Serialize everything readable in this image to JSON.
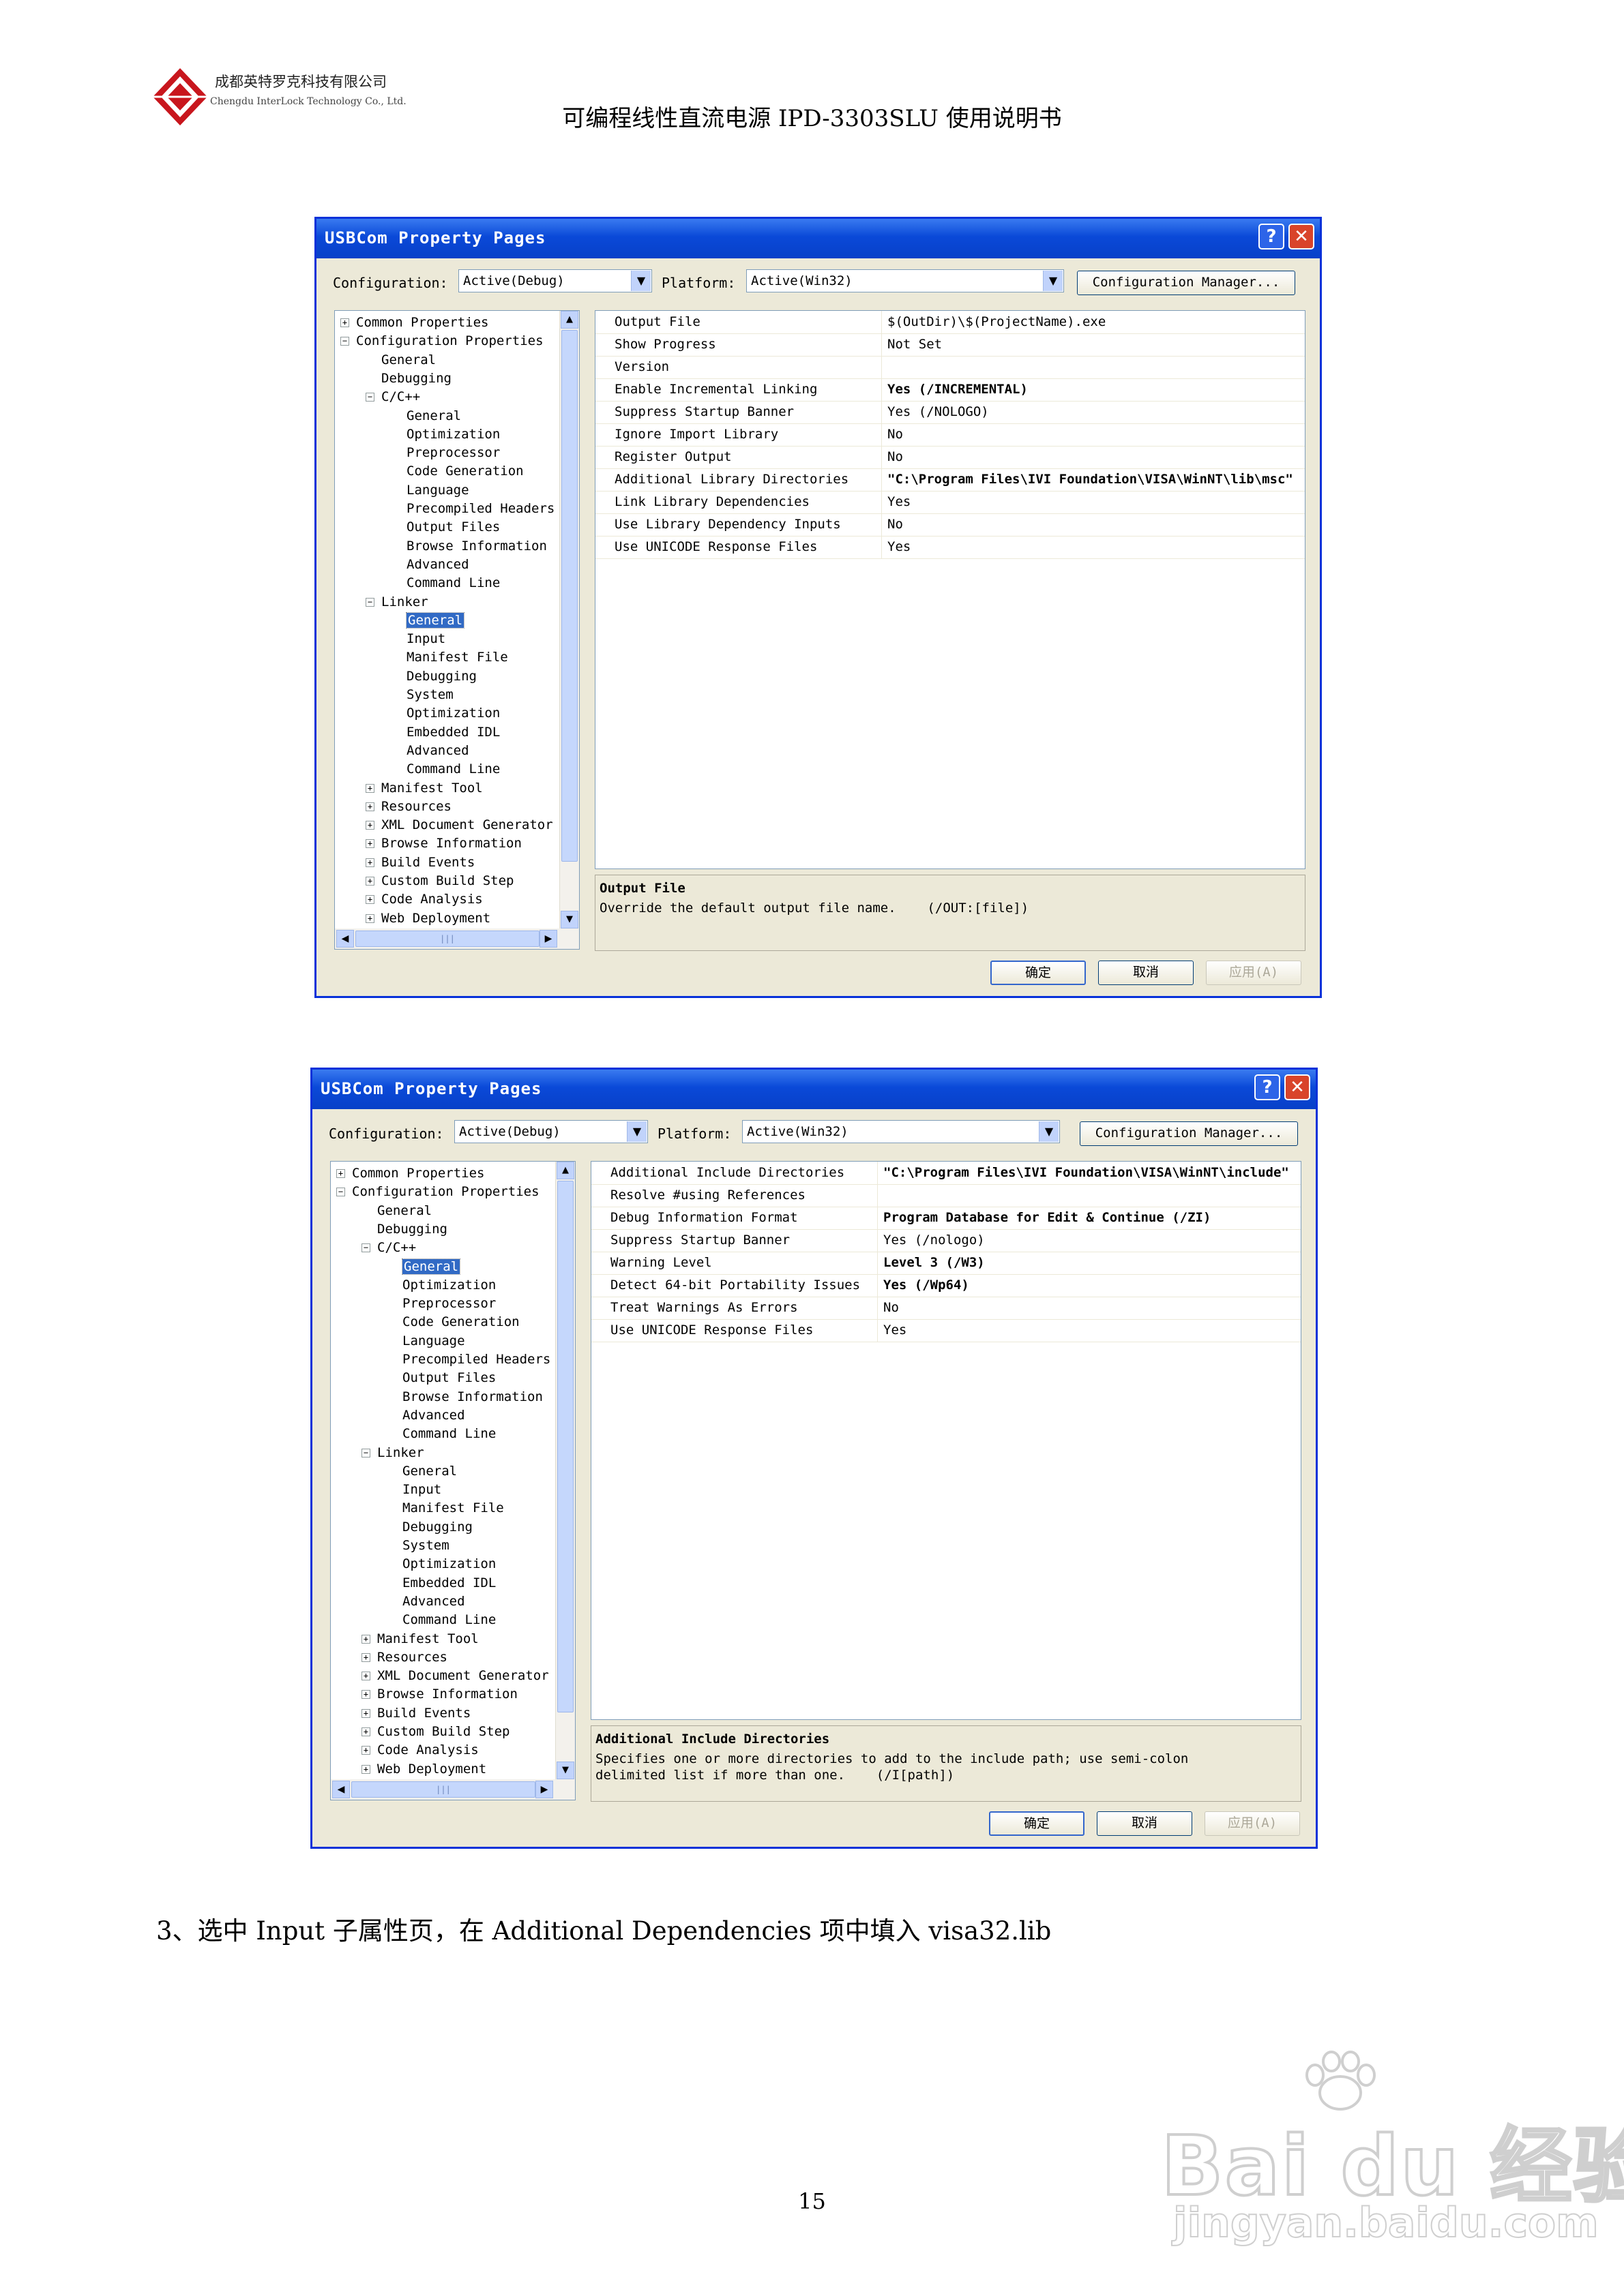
{
  "header": {
    "company_cn": "成都英特罗克科技有限公司",
    "company_en": "Chengdu InterLock Technology Co., Ltd.",
    "doc_title": "可编程线性直流电源 IPD-3303SLU 使用说明书"
  },
  "dialogs": [
    {
      "title": "USBCom Property Pages",
      "help_icon": "?",
      "close_icon": "✕",
      "configuration_label": "Configuration:",
      "configuration_value": "Active(Debug)",
      "platform_label": "Platform:",
      "platform_value": "Active(Win32)",
      "config_manager_label": "Configuration Manager...",
      "tree": [
        {
          "label": "Common Properties",
          "depth": 0,
          "exp": "+"
        },
        {
          "label": "Configuration Properties",
          "depth": 0,
          "exp": "−"
        },
        {
          "label": "General",
          "depth": 1
        },
        {
          "label": "Debugging",
          "depth": 1
        },
        {
          "label": "C/C++",
          "depth": 1,
          "exp": "−"
        },
        {
          "label": "General",
          "depth": 2
        },
        {
          "label": "Optimization",
          "depth": 2
        },
        {
          "label": "Preprocessor",
          "depth": 2
        },
        {
          "label": "Code Generation",
          "depth": 2
        },
        {
          "label": "Language",
          "depth": 2
        },
        {
          "label": "Precompiled Headers",
          "depth": 2
        },
        {
          "label": "Output Files",
          "depth": 2
        },
        {
          "label": "Browse Information",
          "depth": 2
        },
        {
          "label": "Advanced",
          "depth": 2
        },
        {
          "label": "Command Line",
          "depth": 2
        },
        {
          "label": "Linker",
          "depth": 1,
          "exp": "−"
        },
        {
          "label": "General",
          "depth": 2,
          "selected": true
        },
        {
          "label": "Input",
          "depth": 2
        },
        {
          "label": "Manifest File",
          "depth": 2
        },
        {
          "label": "Debugging",
          "depth": 2
        },
        {
          "label": "System",
          "depth": 2
        },
        {
          "label": "Optimization",
          "depth": 2
        },
        {
          "label": "Embedded IDL",
          "depth": 2
        },
        {
          "label": "Advanced",
          "depth": 2
        },
        {
          "label": "Command Line",
          "depth": 2
        },
        {
          "label": "Manifest Tool",
          "depth": 1,
          "exp": "+"
        },
        {
          "label": "Resources",
          "depth": 1,
          "exp": "+"
        },
        {
          "label": "XML Document Generator",
          "depth": 1,
          "exp": "+"
        },
        {
          "label": "Browse Information",
          "depth": 1,
          "exp": "+"
        },
        {
          "label": "Build Events",
          "depth": 1,
          "exp": "+"
        },
        {
          "label": "Custom Build Step",
          "depth": 1,
          "exp": "+"
        },
        {
          "label": "Code Analysis",
          "depth": 1,
          "exp": "+"
        },
        {
          "label": "Web Deployment",
          "depth": 1,
          "exp": "+"
        }
      ],
      "properties": [
        {
          "name": "Output File",
          "value": "$(OutDir)\\$(ProjectName).exe",
          "bold": false
        },
        {
          "name": "Show Progress",
          "value": "Not Set",
          "bold": false
        },
        {
          "name": "Version",
          "value": "",
          "bold": false
        },
        {
          "name": "Enable Incremental Linking",
          "value": "Yes (/INCREMENTAL)",
          "bold": true
        },
        {
          "name": "Suppress Startup Banner",
          "value": "Yes (/NOLOGO)",
          "bold": false
        },
        {
          "name": "Ignore Import Library",
          "value": "No",
          "bold": false
        },
        {
          "name": "Register Output",
          "value": "No",
          "bold": false
        },
        {
          "name": "Additional Library Directories",
          "value": "\"C:\\Program Files\\IVI Foundation\\VISA\\WinNT\\lib\\msc\"",
          "bold": true
        },
        {
          "name": "Link Library Dependencies",
          "value": "Yes",
          "bold": false
        },
        {
          "name": "Use Library Dependency Inputs",
          "value": "No",
          "bold": false
        },
        {
          "name": "Use UNICODE Response Files",
          "value": "Yes",
          "bold": false
        }
      ],
      "desc_title": "Output File",
      "desc_text": "Override the default output file name.    (/OUT:[file])",
      "ok_label": "确定",
      "cancel_label": "取消",
      "apply_label": "应用(A)"
    },
    {
      "title": "USBCom Property Pages",
      "help_icon": "?",
      "close_icon": "✕",
      "configuration_label": "Configuration:",
      "configuration_value": "Active(Debug)",
      "platform_label": "Platform:",
      "platform_value": "Active(Win32)",
      "config_manager_label": "Configuration Manager...",
      "tree": [
        {
          "label": "Common Properties",
          "depth": 0,
          "exp": "+"
        },
        {
          "label": "Configuration Properties",
          "depth": 0,
          "exp": "−"
        },
        {
          "label": "General",
          "depth": 1
        },
        {
          "label": "Debugging",
          "depth": 1
        },
        {
          "label": "C/C++",
          "depth": 1,
          "exp": "−"
        },
        {
          "label": "General",
          "depth": 2,
          "selected": true
        },
        {
          "label": "Optimization",
          "depth": 2
        },
        {
          "label": "Preprocessor",
          "depth": 2
        },
        {
          "label": "Code Generation",
          "depth": 2
        },
        {
          "label": "Language",
          "depth": 2
        },
        {
          "label": "Precompiled Headers",
          "depth": 2
        },
        {
          "label": "Output Files",
          "depth": 2
        },
        {
          "label": "Browse Information",
          "depth": 2
        },
        {
          "label": "Advanced",
          "depth": 2
        },
        {
          "label": "Command Line",
          "depth": 2
        },
        {
          "label": "Linker",
          "depth": 1,
          "exp": "−"
        },
        {
          "label": "General",
          "depth": 2
        },
        {
          "label": "Input",
          "depth": 2
        },
        {
          "label": "Manifest File",
          "depth": 2
        },
        {
          "label": "Debugging",
          "depth": 2
        },
        {
          "label": "System",
          "depth": 2
        },
        {
          "label": "Optimization",
          "depth": 2
        },
        {
          "label": "Embedded IDL",
          "depth": 2
        },
        {
          "label": "Advanced",
          "depth": 2
        },
        {
          "label": "Command Line",
          "depth": 2
        },
        {
          "label": "Manifest Tool",
          "depth": 1,
          "exp": "+"
        },
        {
          "label": "Resources",
          "depth": 1,
          "exp": "+"
        },
        {
          "label": "XML Document Generator",
          "depth": 1,
          "exp": "+"
        },
        {
          "label": "Browse Information",
          "depth": 1,
          "exp": "+"
        },
        {
          "label": "Build Events",
          "depth": 1,
          "exp": "+"
        },
        {
          "label": "Custom Build Step",
          "depth": 1,
          "exp": "+"
        },
        {
          "label": "Code Analysis",
          "depth": 1,
          "exp": "+"
        },
        {
          "label": "Web Deployment",
          "depth": 1,
          "exp": "+"
        }
      ],
      "properties": [
        {
          "name": "Additional Include Directories",
          "value": "\"C:\\Program Files\\IVI Foundation\\VISA\\WinNT\\include\"",
          "bold": true
        },
        {
          "name": "Resolve #using References",
          "value": "",
          "bold": false
        },
        {
          "name": "Debug Information Format",
          "value": "Program Database for Edit & Continue (/ZI)",
          "bold": true
        },
        {
          "name": "Suppress Startup Banner",
          "value": "Yes (/nologo)",
          "bold": false
        },
        {
          "name": "Warning Level",
          "value": "Level 3 (/W3)",
          "bold": true
        },
        {
          "name": "Detect 64-bit Portability Issues",
          "value": "Yes (/Wp64)",
          "bold": true
        },
        {
          "name": "Treat Warnings As Errors",
          "value": "No",
          "bold": false
        },
        {
          "name": "Use UNICODE Response Files",
          "value": "Yes",
          "bold": false
        }
      ],
      "desc_title": "Additional Include Directories",
      "desc_text": "Specifies one or more directories to add to the include path; use semi-colon\ndelimited list if more than one.    (/I[path])",
      "ok_label": "确定",
      "cancel_label": "取消",
      "apply_label": "应用(A)"
    }
  ],
  "step_text": "3、选中 Input 子属性页，在 Additional Dependencies 项中填入 visa32.lib",
  "page_number": "15",
  "watermark": {
    "main": "Bai du 经验",
    "sub": "jingyan.baidu.com"
  }
}
